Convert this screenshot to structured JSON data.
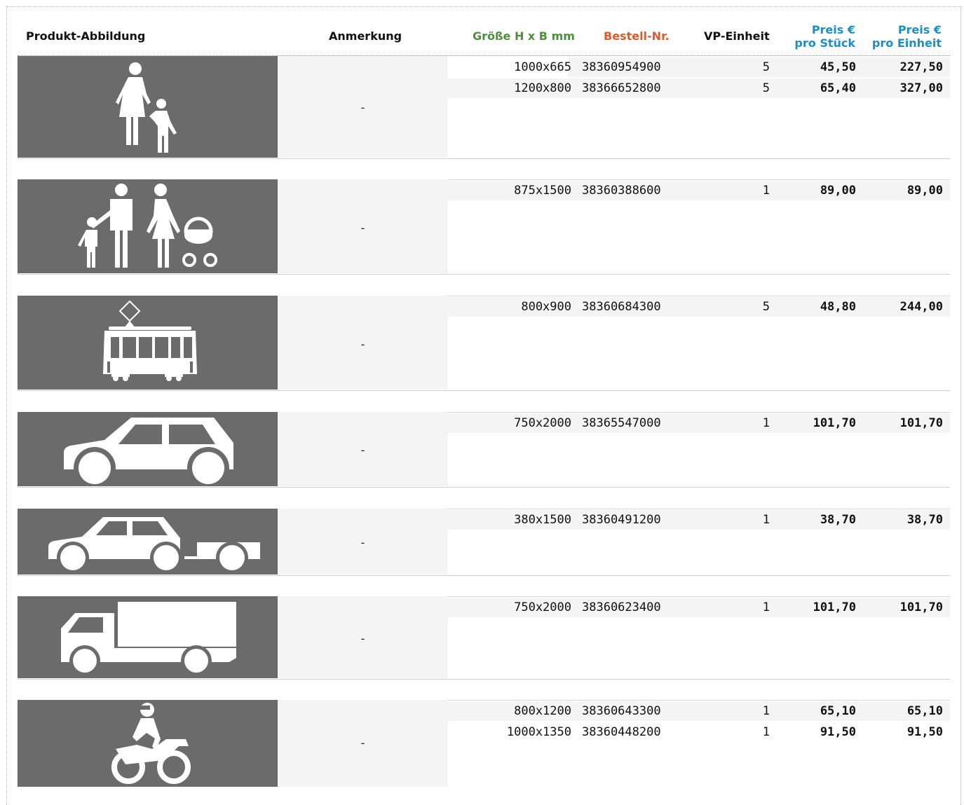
{
  "header": {
    "produkt_abbildung": "Produkt-Abbildung",
    "anmerkung": "Anmerkung",
    "groesse": "Größe H x B mm",
    "bestell_nr": "Bestell-Nr.",
    "vp_einheit": "VP-Einheit",
    "preis_stueck_1": "Preis €",
    "preis_stueck_2": "pro Stück",
    "preis_einheit_1": "Preis €",
    "preis_einheit_2": "pro Einheit"
  },
  "colors": {
    "groesse_header": "#4f8f3c",
    "bestell_header": "#e05a2b",
    "preis_header": "#1b8fc4",
    "symbol_bg": "#6b6b6b"
  },
  "products": [
    {
      "icon": "pedestrian-mother-child-icon",
      "note": "-",
      "variants": [
        {
          "size": "1000x665",
          "nr": "38360954900",
          "vp": "5",
          "p1": "45,50",
          "p2": "227,50"
        },
        {
          "size": "1200x800",
          "nr": "38366652800",
          "vp": "5",
          "p1": "65,40",
          "p2": "327,00"
        }
      ]
    },
    {
      "icon": "family-stroller-icon",
      "note": "-",
      "variants": [
        {
          "size": "875x1500",
          "nr": "38360388600",
          "vp": "1",
          "p1": "89,00",
          "p2": "89,00"
        }
      ]
    },
    {
      "icon": "tram-icon",
      "note": "-",
      "variants": [
        {
          "size": "800x900",
          "nr": "38360684300",
          "vp": "5",
          "p1": "48,80",
          "p2": "244,00"
        }
      ]
    },
    {
      "icon": "car-icon",
      "note": "-",
      "variants": [
        {
          "size": "750x2000",
          "nr": "38365547000",
          "vp": "1",
          "p1": "101,70",
          "p2": "101,70"
        }
      ]
    },
    {
      "icon": "car-with-trailer-icon",
      "note": "-",
      "variants": [
        {
          "size": "380x1500",
          "nr": "38360491200",
          "vp": "1",
          "p1": "38,70",
          "p2": "38,70"
        }
      ]
    },
    {
      "icon": "truck-icon",
      "note": "-",
      "variants": [
        {
          "size": "750x2000",
          "nr": "38360623400",
          "vp": "1",
          "p1": "101,70",
          "p2": "101,70"
        }
      ]
    },
    {
      "icon": "motorcycle-icon",
      "note": "-",
      "variants": [
        {
          "size": "800x1200",
          "nr": "38360643300",
          "vp": "1",
          "p1": "65,10",
          "p2": "65,10"
        },
        {
          "size": "1000x1350",
          "nr": "38360448200",
          "vp": "1",
          "p1": "91,50",
          "p2": "91,50"
        }
      ]
    }
  ]
}
